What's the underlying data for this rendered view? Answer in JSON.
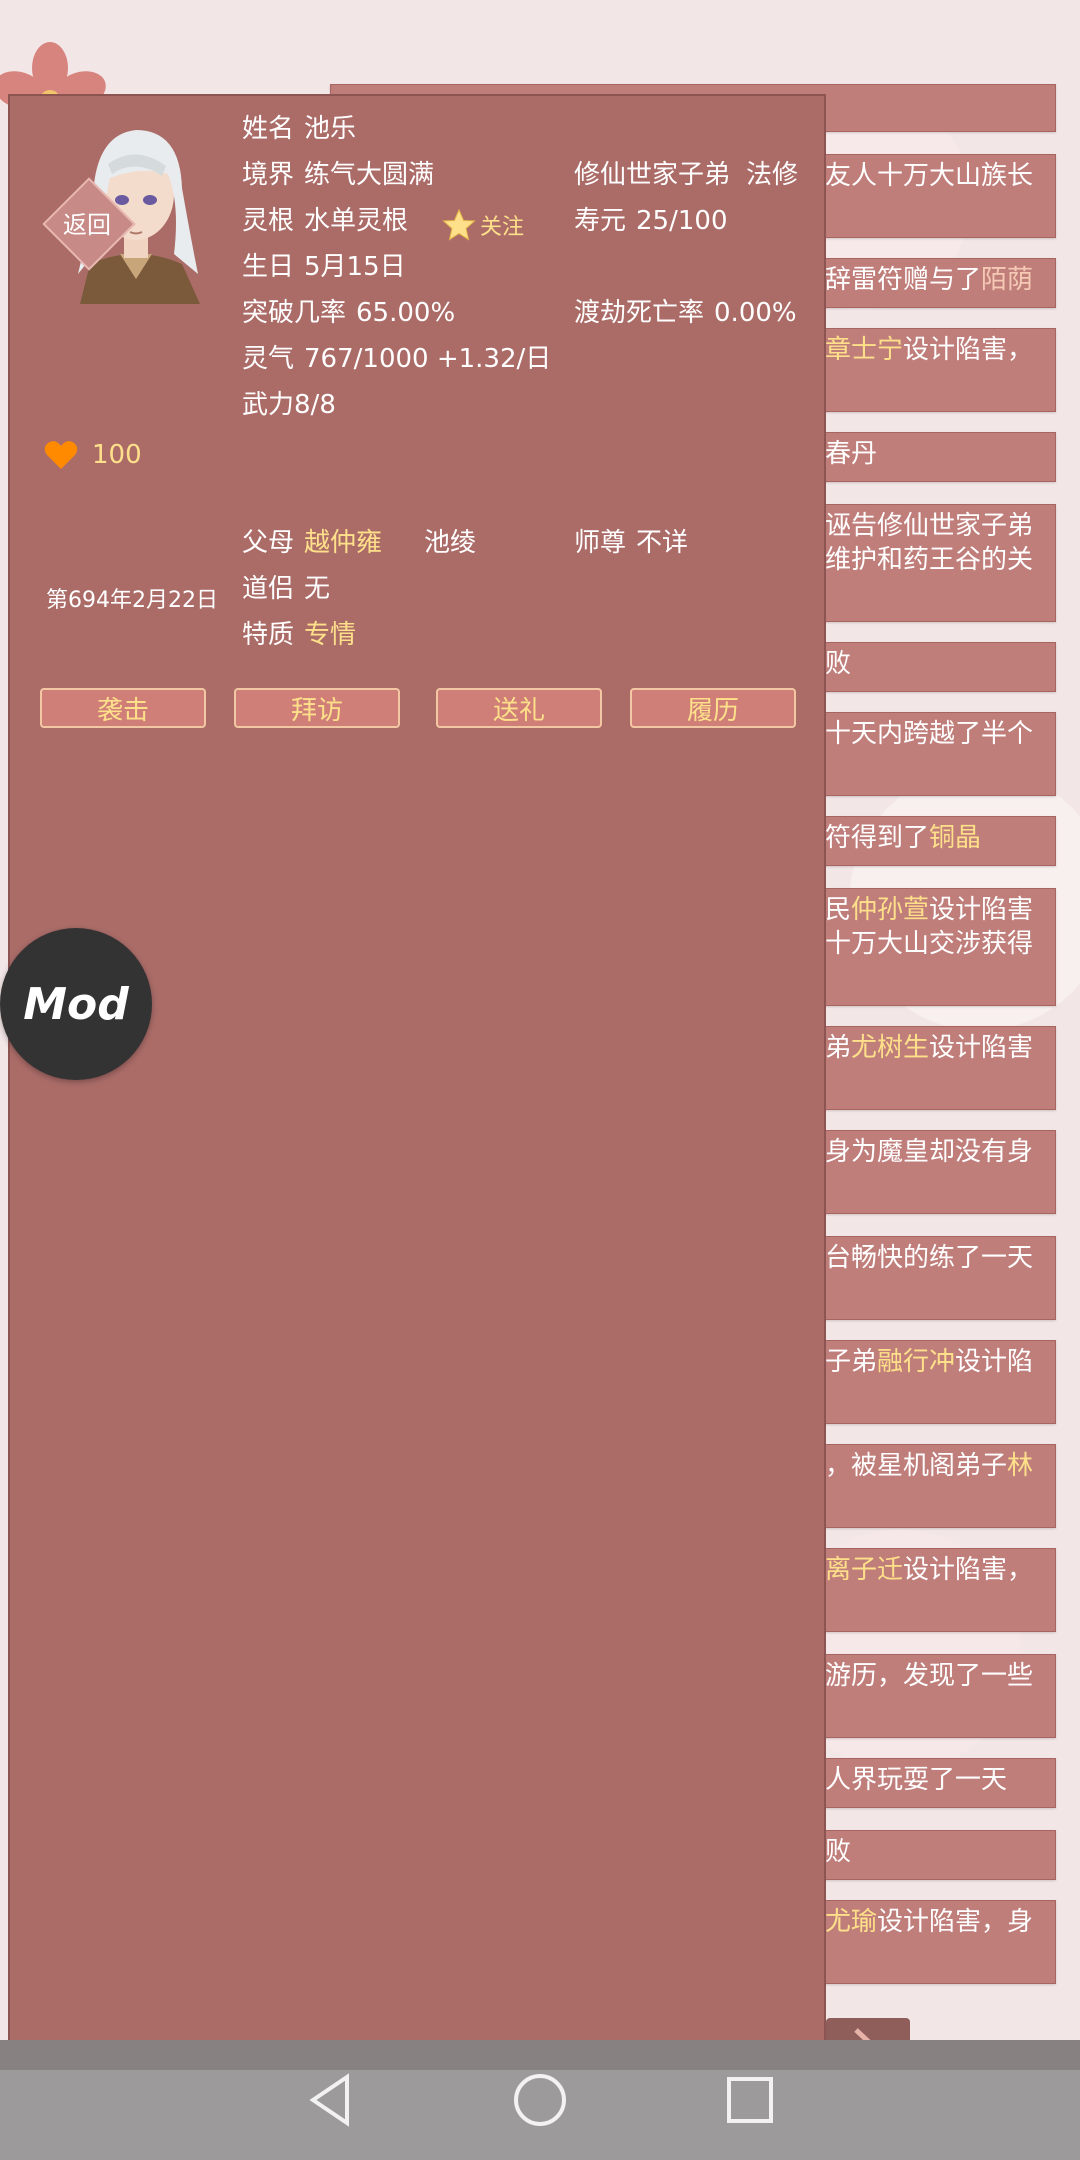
{
  "character": {
    "back_label": "返回",
    "name_label": "姓名",
    "name": "池乐",
    "follow_label": "关注",
    "realm_label": "境界",
    "realm": "练气大圆满",
    "faction": "修仙世家子弟",
    "class": "法修",
    "root_label": "灵根",
    "root": "水单灵根",
    "lifespan_label": "寿元",
    "lifespan": "25/100",
    "birthday_label": "生日",
    "birthday": "5月15日",
    "breakthrough_label": "突破几率",
    "breakthrough": "65.00%",
    "tribulation_label": "渡劫死亡率",
    "tribulation": "0.00%",
    "favor": "100",
    "qi_label": "灵气",
    "qi": "767/1000 +1.32/日",
    "power_label": "武力",
    "power": "8/8",
    "date": "第694年2月22日",
    "parents_label": "父母",
    "father": "越仲雍",
    "mother": "池绫",
    "master_label": "师尊",
    "master": "不详",
    "partner_label": "道侣",
    "partner": "无",
    "trait_label": "特质",
    "trait": "专情"
  },
  "actions": {
    "attack": "袭击",
    "visit": "拜访",
    "gift": "送礼",
    "history": "履历"
  },
  "mod_label": "Mod",
  "logs": [
    {
      "l1": "",
      "l2": ""
    },
    {
      "l1": "友人十万大山族长",
      "l2": ""
    },
    {
      "l1_a": "辞雷符赠与了",
      "l1_b": "陌荫"
    },
    {
      "l1_a": "章士宁",
      "l1_b": "设计陷害，",
      "l2": ""
    },
    {
      "l1": "春丹"
    },
    {
      "l1": "诬告修仙世家子弟",
      "l2": "维护和药王谷的关"
    },
    {
      "l1": "败"
    },
    {
      "l1": "十天内跨越了半个",
      "l2": ""
    },
    {
      "l1_a": "符得到了",
      "l1_b": "铜晶"
    },
    {
      "l1_a": "民",
      "l1_b": "仲孙萱",
      "l1_c": "设计陷害",
      "l2": "十万大山交涉获得"
    },
    {
      "l1_a": "弟",
      "l1_b": "尤树生",
      "l1_c": "设计陷害"
    },
    {
      "l1": "身为魔皇却没有身",
      "l2": ""
    },
    {
      "l1": "台畅快的练了一天",
      "l2": ""
    },
    {
      "l1_a": "子弟",
      "l1_b": "融行冲",
      "l1_c": "设计陷"
    },
    {
      "l1_a": "，被星机阁弟子",
      "l1_b": "林"
    },
    {
      "l1_a": "离子迁",
      "l1_b": "设计陷害，"
    },
    {
      "l1": "游历，发现了一些"
    },
    {
      "l1": "人界玩耍了一天"
    },
    {
      "l1": "败"
    },
    {
      "l1_a": "尤瑜",
      "l1_b": "设计陷害，身"
    }
  ]
}
